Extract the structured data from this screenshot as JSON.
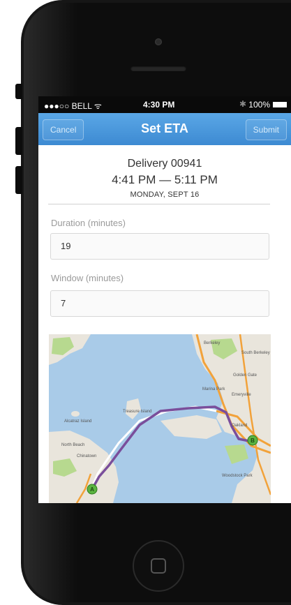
{
  "status_bar": {
    "carrier": "●●●○○ BELL ᯤ",
    "time": "4:30 PM",
    "bluetooth": "✱",
    "battery": "100%"
  },
  "nav": {
    "cancel": "Cancel",
    "title": "Set ETA",
    "submit": "Submit"
  },
  "delivery": {
    "title": "Delivery 00941",
    "time_range": "4:41 PM — 5:11 PM",
    "date": "MONDAY, SEPT 16"
  },
  "form": {
    "duration_label": "Duration (minutes)",
    "duration_value": "19",
    "window_label": "Window (minutes)",
    "window_value": "7"
  },
  "map": {
    "marker_a": "A",
    "marker_b": "B",
    "labels": {
      "treasure_island": "Treasure Island",
      "alcatraz": "Alcatraz Island",
      "emeryville": "Emeryville",
      "golden_gate": "Golden Gate",
      "marina_park": "Marina Park",
      "north_beach": "North Beach",
      "oakland": "Oakland",
      "woodstock": "Woodstock Park",
      "berkeley": "Berkeley",
      "chinatown": "Chinatown",
      "south_berkeley": "South Berkeley"
    },
    "colors": {
      "water": "#a9cbe8",
      "land": "#e9e5dc",
      "park": "#b7d98f",
      "route": "#7a4e9b",
      "highway": "#f2a23a"
    }
  }
}
